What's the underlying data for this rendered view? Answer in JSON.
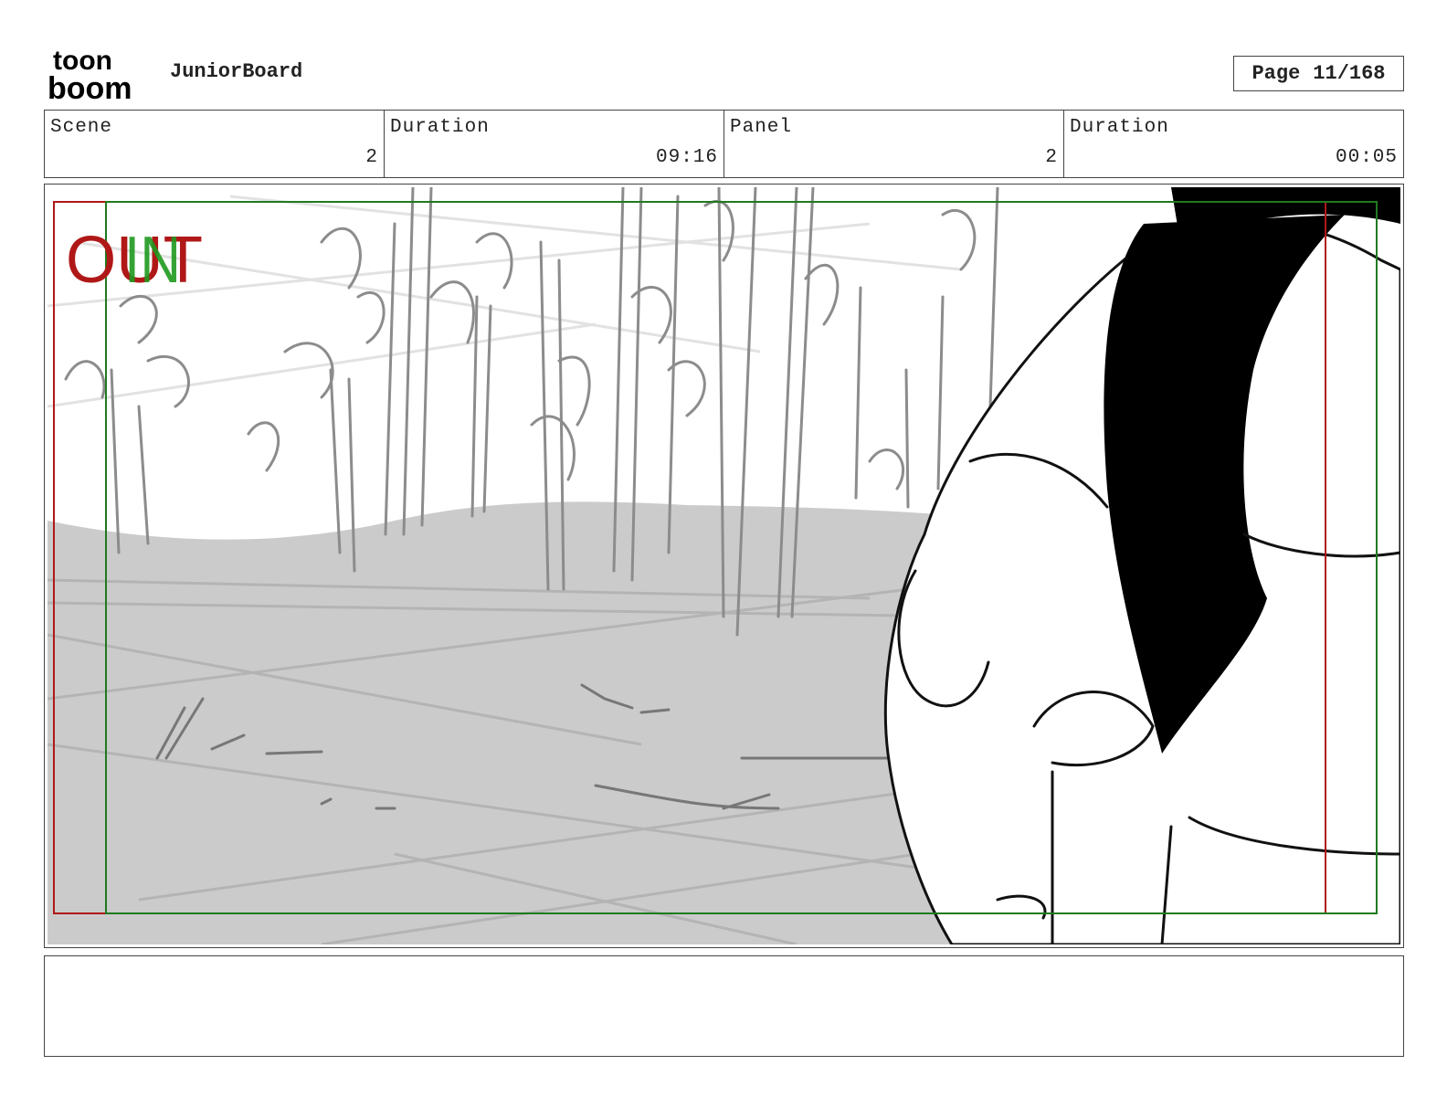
{
  "header": {
    "logo_top": "toon",
    "logo_bottom": "boom",
    "project_title": "JuniorBoard",
    "page_label": "Page",
    "page_number": "11/168"
  },
  "info": [
    {
      "label": "Scene",
      "value": "2"
    },
    {
      "label": "Duration",
      "value": "09:16"
    },
    {
      "label": "Panel",
      "value": "2"
    },
    {
      "label": "Duration",
      "value": "00:05"
    }
  ],
  "panel": {
    "camera_out_label": "OUT",
    "camera_in_label": "IN",
    "colors": {
      "out_frame": "#b01818",
      "in_frame": "#1f7a1f",
      "ground": "#cbcbcb",
      "sketch": "#8a8a8a",
      "ink": "#111111"
    }
  },
  "notes": {
    "text": ""
  }
}
